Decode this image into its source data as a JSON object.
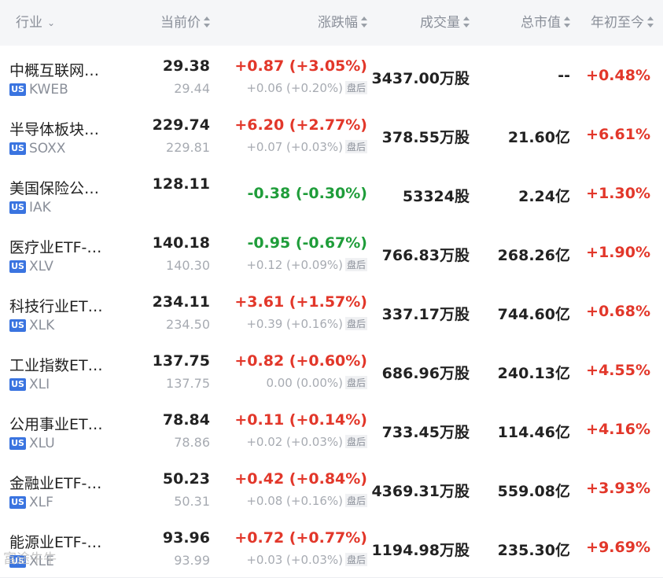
{
  "header": {
    "industry": "行业",
    "price": "当前价",
    "change": "涨跌幅",
    "volume": "成交量",
    "market_cap": "总市值",
    "ytd": "年初至今"
  },
  "market_badge": "US",
  "after_hours_label": "盘后",
  "watermark": "富途牛牛",
  "colors": {
    "up": "#e2372a",
    "down": "#1f9d3a",
    "badge": "#3a74e0"
  },
  "rows": [
    {
      "name": "中概互联网…",
      "code": "KWEB",
      "price": "29.38",
      "price_ah": "29.44",
      "change": "+0.87 (+3.05%)",
      "dir": "up",
      "change_ah": "+0.06 (+0.20%)",
      "volume": "3437.00万股",
      "market_cap": "--",
      "ytd": "+0.48%"
    },
    {
      "name": "半导体板块…",
      "code": "SOXX",
      "price": "229.74",
      "price_ah": "229.81",
      "change": "+6.20 (+2.77%)",
      "dir": "up",
      "change_ah": "+0.07 (+0.03%)",
      "volume": "378.55万股",
      "market_cap": "21.60亿",
      "ytd": "+6.61%"
    },
    {
      "name": "美国保险公…",
      "code": "IAK",
      "price": "128.11",
      "price_ah": "",
      "change": "-0.38 (-0.30%)",
      "dir": "down",
      "change_ah": "",
      "volume": "53324股",
      "market_cap": "2.24亿",
      "ytd": "+1.30%"
    },
    {
      "name": "医疗业ETF-…",
      "code": "XLV",
      "price": "140.18",
      "price_ah": "140.30",
      "change": "-0.95 (-0.67%)",
      "dir": "down",
      "change_ah": "+0.12 (+0.09%)",
      "volume": "766.83万股",
      "market_cap": "268.26亿",
      "ytd": "+1.90%"
    },
    {
      "name": "科技行业ET…",
      "code": "XLK",
      "price": "234.11",
      "price_ah": "234.50",
      "change": "+3.61 (+1.57%)",
      "dir": "up",
      "change_ah": "+0.39 (+0.16%)",
      "volume": "337.17万股",
      "market_cap": "744.60亿",
      "ytd": "+0.68%"
    },
    {
      "name": "工业指数ET…",
      "code": "XLI",
      "price": "137.75",
      "price_ah": "137.75",
      "change": "+0.82 (+0.60%)",
      "dir": "up",
      "change_ah": "0.00 (0.00%)",
      "volume": "686.96万股",
      "market_cap": "240.13亿",
      "ytd": "+4.55%"
    },
    {
      "name": "公用事业ET…",
      "code": "XLU",
      "price": "78.84",
      "price_ah": "78.86",
      "change": "+0.11 (+0.14%)",
      "dir": "up",
      "change_ah": "+0.02 (+0.03%)",
      "volume": "733.45万股",
      "market_cap": "114.46亿",
      "ytd": "+4.16%"
    },
    {
      "name": "金融业ETF-…",
      "code": "XLF",
      "price": "50.23",
      "price_ah": "50.31",
      "change": "+0.42 (+0.84%)",
      "dir": "up",
      "change_ah": "+0.08 (+0.16%)",
      "volume": "4369.31万股",
      "market_cap": "559.08亿",
      "ytd": "+3.93%"
    },
    {
      "name": "能源业ETF-…",
      "code": "XLE",
      "price": "93.96",
      "price_ah": "93.99",
      "change": "+0.72 (+0.77%)",
      "dir": "up",
      "change_ah": "+0.03 (+0.03%)",
      "volume": "1194.98万股",
      "market_cap": "235.30亿",
      "ytd": "+9.69%"
    }
  ]
}
